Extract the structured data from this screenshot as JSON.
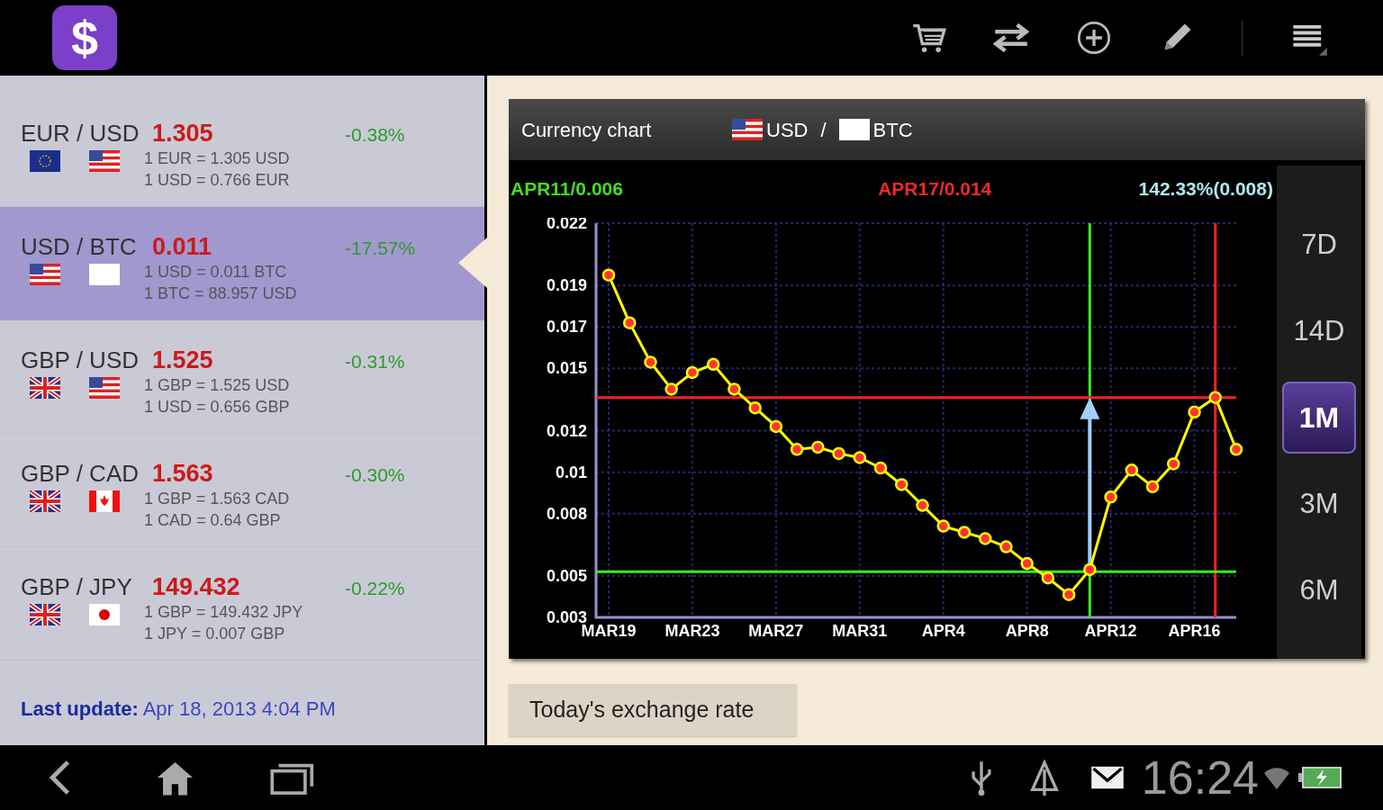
{
  "app_logo": {
    "symbol": "$"
  },
  "action_bar": {
    "actions": [
      {
        "kind": "cart"
      },
      {
        "kind": "swap"
      },
      {
        "kind": "add"
      },
      {
        "kind": "edit"
      },
      {
        "kind": "menu"
      }
    ]
  },
  "pairs": [
    {
      "pair": "EUR / USD",
      "rate": "1.305",
      "change": "-0.38%",
      "flags": [
        {
          "kind": "eu"
        },
        {
          "kind": "us"
        }
      ],
      "line_1": "1 EUR = 1.305 USD",
      "line_2": "1 USD = 0.766 EUR",
      "selected": false
    },
    {
      "pair": "USD / BTC",
      "rate": "0.011",
      "change": "-17.57%",
      "flags": [
        {
          "kind": "us"
        },
        {
          "kind": "blank"
        }
      ],
      "line_1": "1 USD = 0.011 BTC",
      "line_2": "1 BTC = 88.957 USD",
      "selected": true
    },
    {
      "pair": "GBP / USD",
      "rate": "1.525",
      "change": "-0.31%",
      "flags": [
        {
          "kind": "gb"
        },
        {
          "kind": "us"
        }
      ],
      "line_1": "1 GBP = 1.525 USD",
      "line_2": "1 USD = 0.656 GBP",
      "selected": false
    },
    {
      "pair": "GBP / CAD",
      "rate": "1.563",
      "change": "-0.30%",
      "flags": [
        {
          "kind": "gb"
        },
        {
          "kind": "ca"
        }
      ],
      "line_1": "1 GBP = 1.563 CAD",
      "line_2": "1 CAD = 0.64 GBP",
      "selected": false
    },
    {
      "pair": "GBP / JPY",
      "rate": "149.432",
      "change": "-0.22%",
      "flags": [
        {
          "kind": "gb"
        },
        {
          "kind": "jp"
        }
      ],
      "line_1": "1 GBP = 149.432 JPY",
      "line_2": "1 JPY = 0.007 GBP",
      "selected": false
    }
  ],
  "last_update": "**Last update:** Apr 18, 2013 4:04 PM",
  "chart_panel": {
    "title": "Currency chart",
    "base": {
      "code": "USD",
      "flag": {
        "kind": "us"
      }
    },
    "separator": "/",
    "quote": {
      "code": "BTC",
      "flag": {
        "kind": "blank"
      }
    },
    "start_label": "APR11/0.006",
    "end_label": "APR17/0.014",
    "change_label": "142.33%(0.008)",
    "periods": [
      {
        "label": "7D",
        "selected": false
      },
      {
        "label": "14D",
        "selected": false
      },
      {
        "label": "1M",
        "selected": true
      },
      {
        "label": "3M",
        "selected": false
      },
      {
        "label": "6M",
        "selected": false
      }
    ],
    "chart_data": {
      "type": "line",
      "categories": [
        "MAR19",
        null,
        null,
        null,
        "MAR23",
        null,
        null,
        null,
        "MAR27",
        null,
        null,
        null,
        "MAR31",
        null,
        null,
        null,
        "APR4",
        null,
        null,
        null,
        "APR8",
        null,
        null,
        null,
        "APR12",
        null,
        null,
        null,
        "APR16",
        null,
        null
      ],
      "grid": true,
      "ref_lines": [
        {
          "axis": "y",
          "value": 0.0136,
          "color": "#ff2020"
        },
        {
          "axis": "y",
          "value": 0.0052,
          "color": "#33ee22"
        }
      ],
      "series": [
        {
          "color": "#ffff00",
          "marker": "circle",
          "values": [
            0.0195,
            0.0172,
            0.0153,
            0.014,
            0.0148,
            0.0152,
            0.014,
            0.0131,
            0.0122,
            0.0111,
            0.0112,
            0.0109,
            0.0107,
            0.0102,
            0.0094,
            0.0084,
            0.0074,
            0.0071,
            0.0068,
            0.0064,
            0.0056,
            0.0049,
            0.0041,
            0.0053,
            0.0088,
            0.0101,
            0.0093,
            0.0104,
            0.0129,
            0.0136,
            0.0111
          ]
        }
      ],
      "ylim": [
        0.003,
        0.022
      ],
      "yticks": [
        {
          "value": 0.003,
          "label": "0.003"
        },
        {
          "value": 0.005,
          "label": "0.005"
        },
        {
          "value": 0.008,
          "label": "0.008"
        },
        {
          "value": 0.01,
          "label": "0.01"
        },
        {
          "value": 0.012,
          "label": "0.012"
        },
        {
          "value": 0.015,
          "label": "0.015"
        },
        {
          "value": 0.017,
          "label": "0.017"
        },
        {
          "value": 0.019,
          "label": "0.019"
        },
        {
          "value": 0.022,
          "label": "0.022"
        }
      ]
    }
  },
  "today_button": "Today's exchange rate",
  "nav_bar": {
    "buttons": [
      {
        "kind": "back"
      },
      {
        "kind": "home"
      },
      {
        "kind": "recent"
      }
    ],
    "status_icons": [
      {
        "kind": "usb"
      },
      {
        "kind": "upload"
      },
      {
        "kind": "mail"
      }
    ],
    "time": "16:24"
  }
}
